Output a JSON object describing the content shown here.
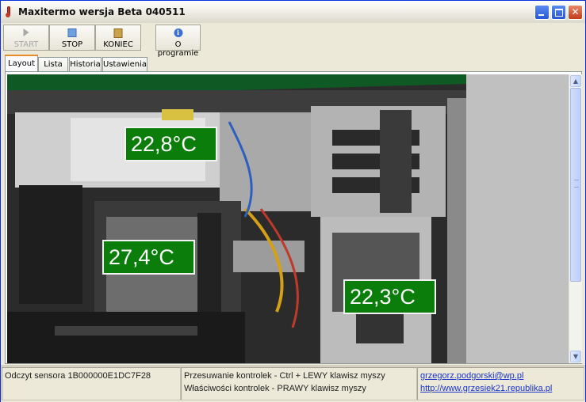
{
  "window": {
    "title": "Maxitermo wersja Beta 040511",
    "controls": {
      "minimize": "minimize",
      "maximize": "maximize",
      "close": "close"
    }
  },
  "toolbar": {
    "start_label": "START",
    "stop_label": "STOP",
    "koniec_label": "KONIEC",
    "about_label": "O programie"
  },
  "tabs": [
    {
      "label": "Layout",
      "active": true
    },
    {
      "label": "Lista",
      "active": false
    },
    {
      "label": "Historia",
      "active": false
    },
    {
      "label": "Ustawienia",
      "active": false
    }
  ],
  "layout": {
    "sensors": [
      {
        "reading": "22,8°C",
        "location": "power-supply"
      },
      {
        "reading": "27,4°C",
        "location": "cpu"
      },
      {
        "reading": "22,3°C",
        "location": "drive-bay"
      }
    ],
    "label_color": "#0a7d0a"
  },
  "statusbar": {
    "sensor_reading": "Odczyt sensora 1B000000E1DC7F28",
    "hint_move": "Przesuwanie kontrolek - Ctrl + LEWY klawisz myszy",
    "hint_props": "Właściwości kontrolek - PRAWY klawisz myszy",
    "email": "grzegorz.podgorski@wp.pl",
    "website": "http://www.grzesiek21.republika.pl"
  }
}
